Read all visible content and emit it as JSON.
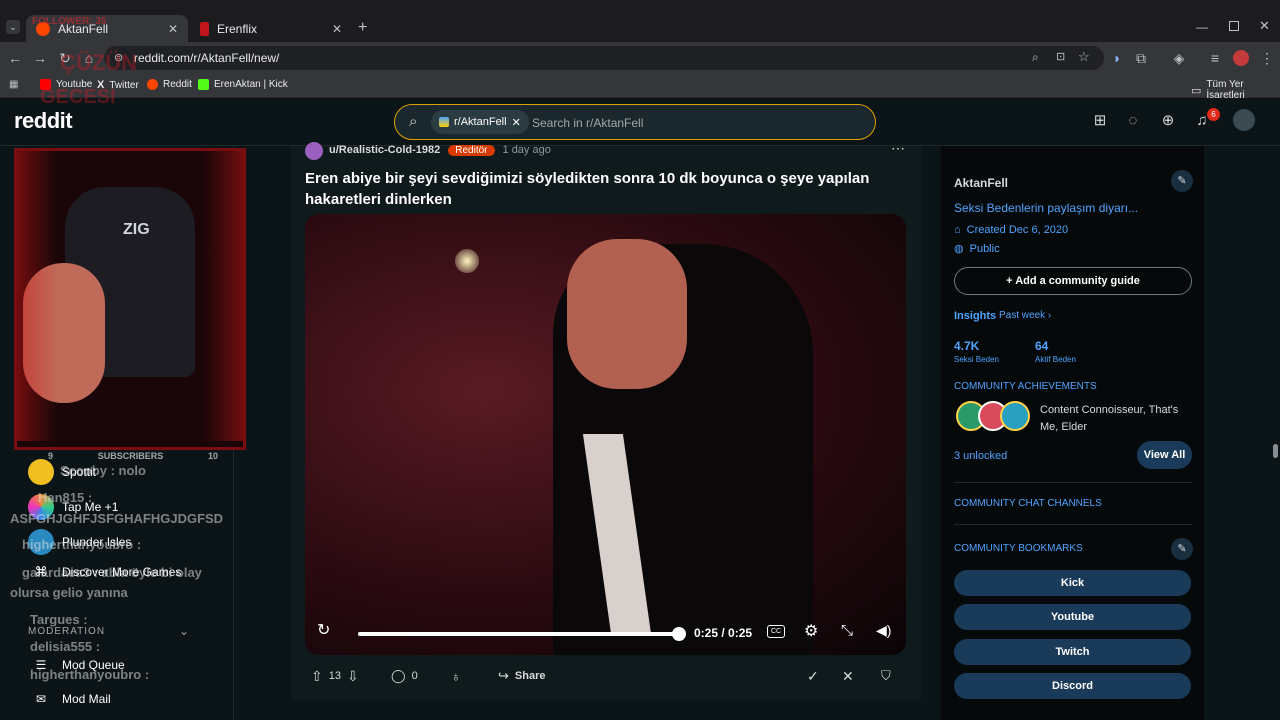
{
  "browser": {
    "tabs": [
      {
        "title": "AktanFell",
        "active": true
      },
      {
        "title": "Erenflix",
        "active": false
      }
    ],
    "url": "reddit.com/r/AktanFell/new/",
    "bookmarks": [
      "Youtube",
      "Twitter",
      "Reddit",
      "ErenAktan | Kick"
    ],
    "all_bookmarks": "Tüm Yer İşaretleri",
    "overlay_text": [
      "FOLLOWER: 35",
      "ÇÜZÜN",
      "GECESI"
    ]
  },
  "header": {
    "logo": "reddit",
    "search_chip": "r/AktanFell",
    "search_placeholder": "Search in r/AktanFell",
    "notif_count": "6"
  },
  "left_sidebar": {
    "items": [
      {
        "label": "Spottit",
        "icon": "spottit-game-icon"
      },
      {
        "label": "Tap Me +1",
        "icon": "tapme-game-icon"
      },
      {
        "label": "Plunder Isles",
        "icon": "plunder-isles-icon"
      },
      {
        "label": "Discover More Games",
        "icon": "gamepad-icon"
      }
    ],
    "section_moderation": "MODERATION",
    "mod_items": [
      "Mod Queue",
      "Mod Mail"
    ],
    "subscribers_label": "SUBSCRIBERS",
    "subscribers_left": "9",
    "subscribers_right": "10",
    "chat_lines": [
      "Scooby : nolo",
      "Han815 :",
      "ASFGHJGHFJSFGHAFHGJDGFSD",
      "higherthanyoubro :",
      "galardaea3 : abla öyle bi olay",
      "olursa gelio yanına",
      "Targues :",
      "delisia555 :",
      "higherthanyoubro :"
    ]
  },
  "post": {
    "author": "u/Realistic-Cold-1982",
    "flair": "Reditör",
    "age": "1 day ago",
    "title": "Eren abiye bir şeyi sevdiğimizi söyledikten sonra 10 dk boyunca o şeye yapılan hakaretleri dinlerken",
    "video_time": "0:25 / 0:25",
    "progress": 1.0,
    "votes": "13",
    "comments": "0",
    "share": "Share"
  },
  "community": {
    "name": "AktanFell",
    "description": "Seksi Bedenlerin paylaşım diyarı...",
    "created": "Created Dec 6, 2020",
    "visibility": "Public",
    "add_guide": "Add a community guide",
    "insights_label": "Insights",
    "insights_range": "Past week",
    "stat1_value": "4.7K",
    "stat1_label": "Seksi Beden",
    "stat2_value": "64",
    "stat2_label": "Aktif Beden",
    "achievements_title": "COMMUNITY ACHIEVEMENTS",
    "achievements_text": "Content Connoisseur, That's Me, Elder",
    "unlocked": "3 unlocked",
    "view_all": "View All",
    "chat_channels": "COMMUNITY CHAT CHANNELS",
    "bookmarks_title": "COMMUNITY BOOKMARKS",
    "bookmark_buttons": [
      "Kick",
      "Youtube",
      "Twitch",
      "Discord"
    ]
  },
  "colors": {
    "accent_blue": "#4fa3ff",
    "flair_orange": "#d93a00",
    "search_border": "#e0a000",
    "pill_bg": "#1a3a5a",
    "stream_red": "#7a0d12"
  }
}
